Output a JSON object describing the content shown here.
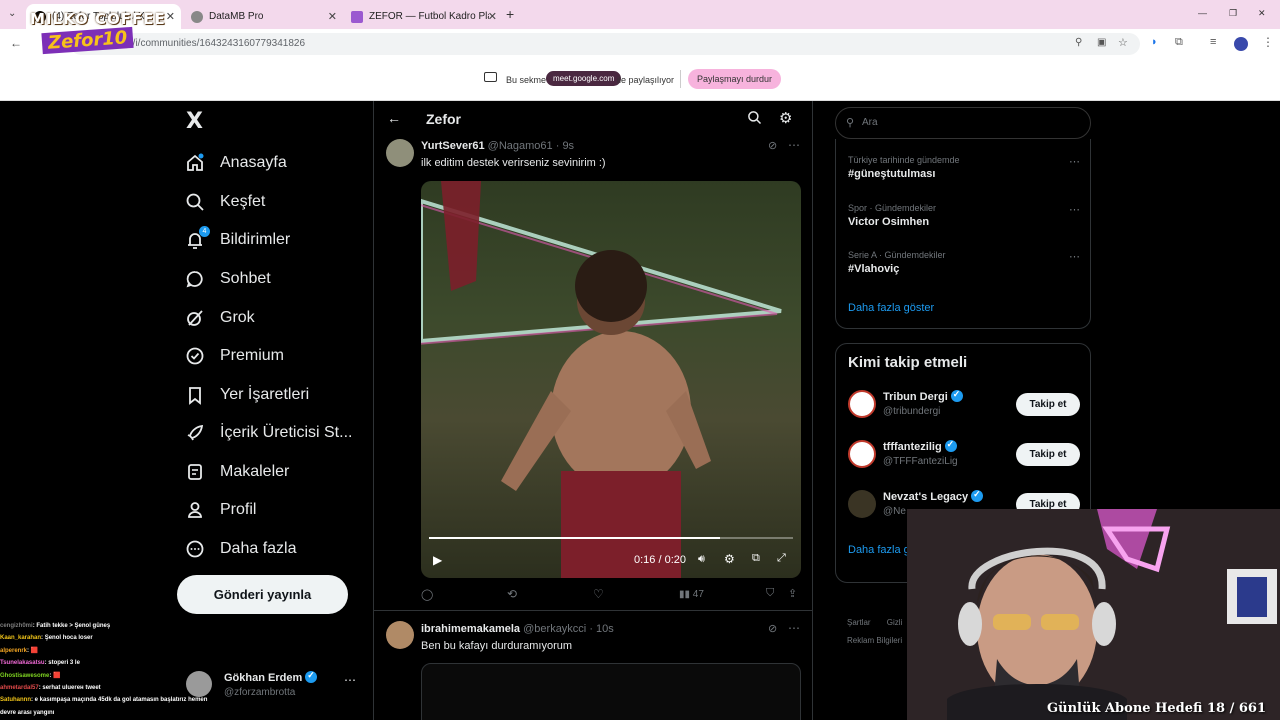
{
  "browser": {
    "tabs": [
      {
        "label": "(4) Zefor Topluluk / X",
        "active": true
      },
      {
        "label": "DataMB Pro",
        "active": false
      },
      {
        "label": "ZEFOR — Futbol Kadro Planları",
        "active": false
      }
    ],
    "new_tab": "+",
    "url": "x.com/i/communities/1643243160779341826",
    "share_notice": {
      "prefix": "Bu sekme",
      "domain": "meet.google.com",
      "suffix": "ile paylaşılıyor",
      "stop_button": "Paylaşmayı durdur"
    },
    "window_controls": [
      "—",
      "❐",
      "✕"
    ]
  },
  "overlay_logo": {
    "line1": "MILKO COFFEE",
    "line2": "Zefor10"
  },
  "sidebar": {
    "logo": "X",
    "items": [
      {
        "label": "Anasayfa",
        "icon": "home-icon"
      },
      {
        "label": "Keşfet",
        "icon": "search-icon"
      },
      {
        "label": "Bildirimler",
        "icon": "bell-icon",
        "badge": "4"
      },
      {
        "label": "Sohbet",
        "icon": "chat-icon"
      },
      {
        "label": "Grok",
        "icon": "grok-icon"
      },
      {
        "label": "Premium",
        "icon": "premium-icon"
      },
      {
        "label": "Yer İşaretleri",
        "icon": "bookmark-icon"
      },
      {
        "label": "İçerik Üreticisi St...",
        "icon": "rocket-icon"
      },
      {
        "label": "Makaleler",
        "icon": "article-icon"
      },
      {
        "label": "Profil",
        "icon": "person-icon"
      },
      {
        "label": "Daha fazla",
        "icon": "more-circle-icon"
      }
    ],
    "post_button": "Gönderi yayınla",
    "account": {
      "name": "Gökhan Erdem",
      "handle": "@zforzambrotta"
    }
  },
  "center": {
    "title": "Zefor",
    "tweets": [
      {
        "name": "YurtSever61",
        "handle": "@Nagamo61",
        "time": "· 9s",
        "text": "ilk editim destek verirseniz sevinirim :)",
        "video": {
          "current": "0:16",
          "total": "0:20",
          "progress": 0.8
        },
        "views": "47"
      },
      {
        "name": "ibrahimemakamela",
        "handle": "@berkaykcci",
        "time": "· 10s",
        "text": "Ben bu kafayı durduramıyorum"
      }
    ]
  },
  "right": {
    "search_placeholder": "Ara",
    "trends": [
      {
        "category": "Türkiye tarihinde gündemde",
        "title": "#güneştutulması"
      },
      {
        "category": "Spor · Gündemdekiler",
        "title": "Victor Osimhen"
      },
      {
        "category": "Serie A · Gündemdekiler",
        "title": "#Vlahoviç"
      }
    ],
    "show_more": "Daha fazla göster",
    "who_to_follow": {
      "heading": "Kimi takip etmeli",
      "accounts": [
        {
          "name": "Tribun Dergi",
          "handle": "@tribundergi",
          "button": "Takip et"
        },
        {
          "name": "tfffantezilig",
          "handle": "@TFFFanteziLig",
          "button": "Takip et"
        },
        {
          "name": "Nevzat's Legacy",
          "handle": "@Ne",
          "button": "Takip et"
        }
      ],
      "show_more": "Daha fazla g"
    },
    "footer": {
      "links": [
        "Şartlar",
        "Gizli"
      ],
      "ads": "Reklam Bilgileri"
    }
  },
  "chat": [
    {
      "user": "cengizh0mi",
      "msg": ": Fatih tekke > Şenol güneş",
      "color": "#7d7d7d"
    },
    {
      "user": "Kaan_karahan",
      "msg": ": Şenol hoca loser",
      "color": "#f0c419"
    },
    {
      "user": "alperenrk",
      "msg": ": 🟥",
      "color": "#f5a623"
    },
    {
      "user": "Tsunelakasatsu",
      "msg": ": stoperi 3 le",
      "color": "#f06ad6"
    },
    {
      "user": "Ghostisawesome",
      "msg": ": 🟥",
      "color": "#7ed321"
    },
    {
      "user": "ahmetardal57",
      "msg": ": serhat uluerен tweet",
      "color": "#e24a4a"
    },
    {
      "user": "Satuhannn",
      "msg": ": e kasımpaşa maçında 45dk da gol atamasın başlatırız hemen",
      "color": "#f0c419"
    },
    {
      "user": "",
      "msg": "devre arası yangını",
      "color": "#ffffff"
    }
  ],
  "stream_goal": "Günlük Abone Hedefi 18 / 661"
}
